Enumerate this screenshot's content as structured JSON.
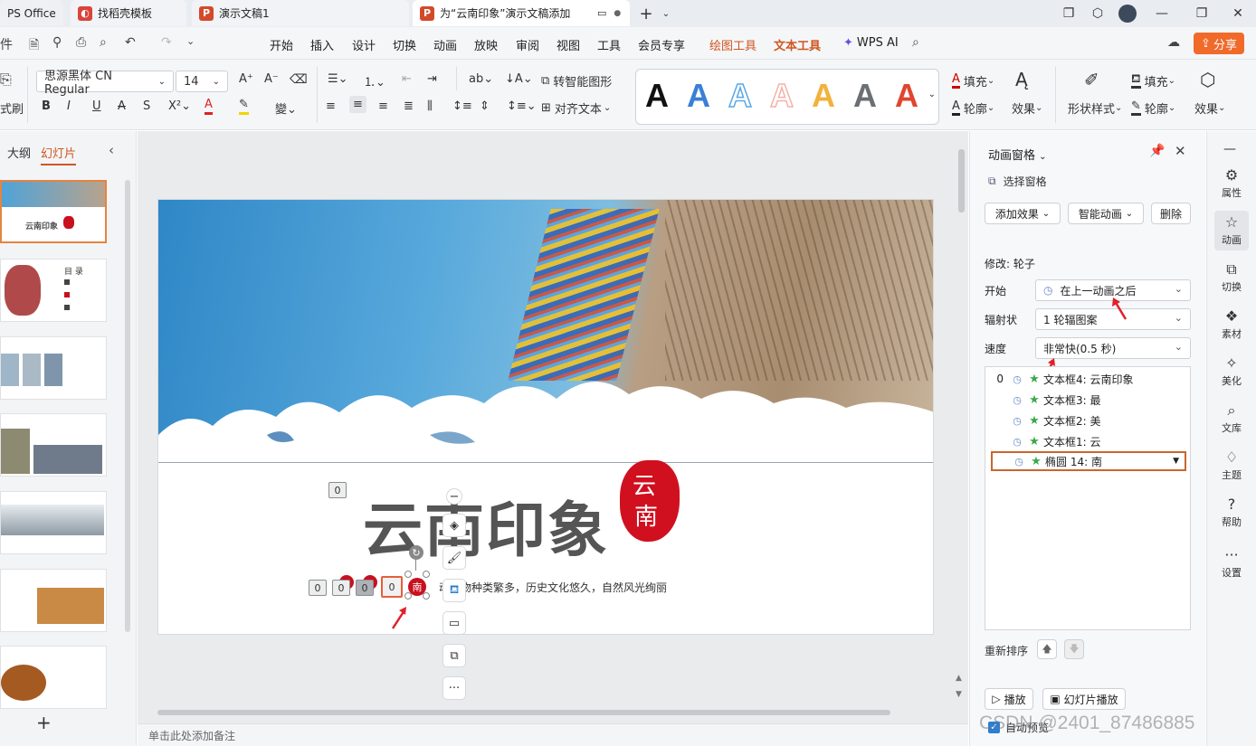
{
  "titlebar": {
    "tabs": [
      {
        "label": "PS Office"
      },
      {
        "label": "找稻壳模板"
      },
      {
        "label": "演示文稿1"
      },
      {
        "label": "为“云南印象”演示文稿添加"
      }
    ],
    "new_tab": "+"
  },
  "menubar": {
    "items": [
      "开始",
      "插入",
      "设计",
      "切换",
      "动画",
      "放映",
      "审阅",
      "视图",
      "工具",
      "会员专享",
      "绘图工具",
      "文本工具"
    ],
    "wps_ai": "WPS AI",
    "share": "分享"
  },
  "ribbon": {
    "format_brush": "式刷",
    "font_name": "思源黑体 CN Regular",
    "font_size": "14",
    "convert_smart": "转智能图形",
    "align_text": "对齐文本",
    "fill": "填充",
    "outline": "轮廓",
    "effect": "效果",
    "shape_style": "形状样式",
    "fill2": "填充",
    "outline2": "轮廓",
    "effect2": "效果",
    "styles": [
      {
        "letter": "A",
        "color": "#111111"
      },
      {
        "letter": "A",
        "color": "#3b7fd6"
      },
      {
        "letter": "A",
        "color": "#5aa8e6"
      },
      {
        "letter": "A",
        "color": "#f3b3a8"
      },
      {
        "letter": "A",
        "color": "#f2b23a"
      },
      {
        "letter": "A",
        "color": "#6b6e73"
      },
      {
        "letter": "A",
        "color": "#e0452f"
      }
    ]
  },
  "leftpane": {
    "tab_outline": "大纲",
    "tab_slides": "幻灯片",
    "add_button": "+",
    "thumb1_title": "云南印象",
    "thumb2_title": "目 录"
  },
  "slide": {
    "title": "云南印象",
    "seal_top": "云",
    "seal_bottom": "南",
    "subtitle": "动植物种类繁多，历史文化悠久，自然风光绚丽",
    "small_char": "南",
    "tag_values": [
      "0",
      "0",
      "0",
      "0",
      "0"
    ]
  },
  "notes": {
    "placeholder": "单击此处添加备注"
  },
  "animpane": {
    "title": "动画窗格",
    "select_pane": "选择窗格",
    "add_effect": "添加效果",
    "smart_anim": "智能动画",
    "delete": "删除",
    "modify": "修改: 轮子",
    "start_label": "开始",
    "start_value": "在上一动画之后",
    "spokes_label": "辐射状",
    "spokes_value": "1 轮辐图案",
    "speed_label": "速度",
    "speed_value": "非常快(0.5 秒)",
    "items": [
      {
        "num": "0",
        "label": "文本框4: 云南印象"
      },
      {
        "num": "",
        "label": "文本框3: 最"
      },
      {
        "num": "",
        "label": "文本框2: 美"
      },
      {
        "num": "",
        "label": "文本框1: 云"
      },
      {
        "num": "",
        "label": "椭圆 14: 南"
      }
    ],
    "reorder": "重新排序",
    "play": "播放",
    "slideshow": "幻灯片播放",
    "autopreview": "自动预览"
  },
  "sidebar": {
    "items": [
      "属性",
      "动画",
      "切换",
      "素材",
      "美化",
      "文库",
      "主题",
      "帮助",
      "设置"
    ]
  },
  "watermark": "CSDN @2401_87486885"
}
